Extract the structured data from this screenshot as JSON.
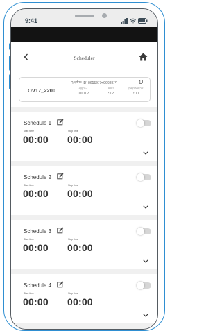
{
  "status_bar": {
    "time": "9:41"
  },
  "header": {
    "title": "Scheduler"
  },
  "device": {
    "name": "OV17_2200",
    "unique_id": "Unique ID: 86229194868931d",
    "stats": [
      {
        "value": "2/10001",
        "label": "Profile"
      },
      {
        "value": "20.2",
        "label": "Zone"
      },
      {
        "value": "11.2",
        "label": "Scheduled"
      }
    ]
  },
  "schedules": [
    {
      "title": "Schedule 1",
      "start_label": "Start time",
      "start_value": "00:00",
      "stop_label": "Stop time",
      "stop_value": "00:00",
      "enabled": false
    },
    {
      "title": "Schedule 2",
      "start_label": "Start time",
      "start_value": "00:00",
      "stop_label": "Stop time",
      "stop_value": "00:00",
      "enabled": false
    },
    {
      "title": "Schedule 3",
      "start_label": "Start time",
      "start_value": "00:00",
      "stop_label": "Stop time",
      "stop_value": "00:00",
      "enabled": false
    },
    {
      "title": "Schedule 4",
      "start_label": "Start time",
      "start_value": "00:00",
      "stop_label": "Stop time",
      "stop_value": "00:00",
      "enabled": false
    }
  ],
  "colors": {
    "frame": "#2f8fd2",
    "app_bg": "#f0f0f0",
    "toggle_off": "#d6d6d6"
  }
}
